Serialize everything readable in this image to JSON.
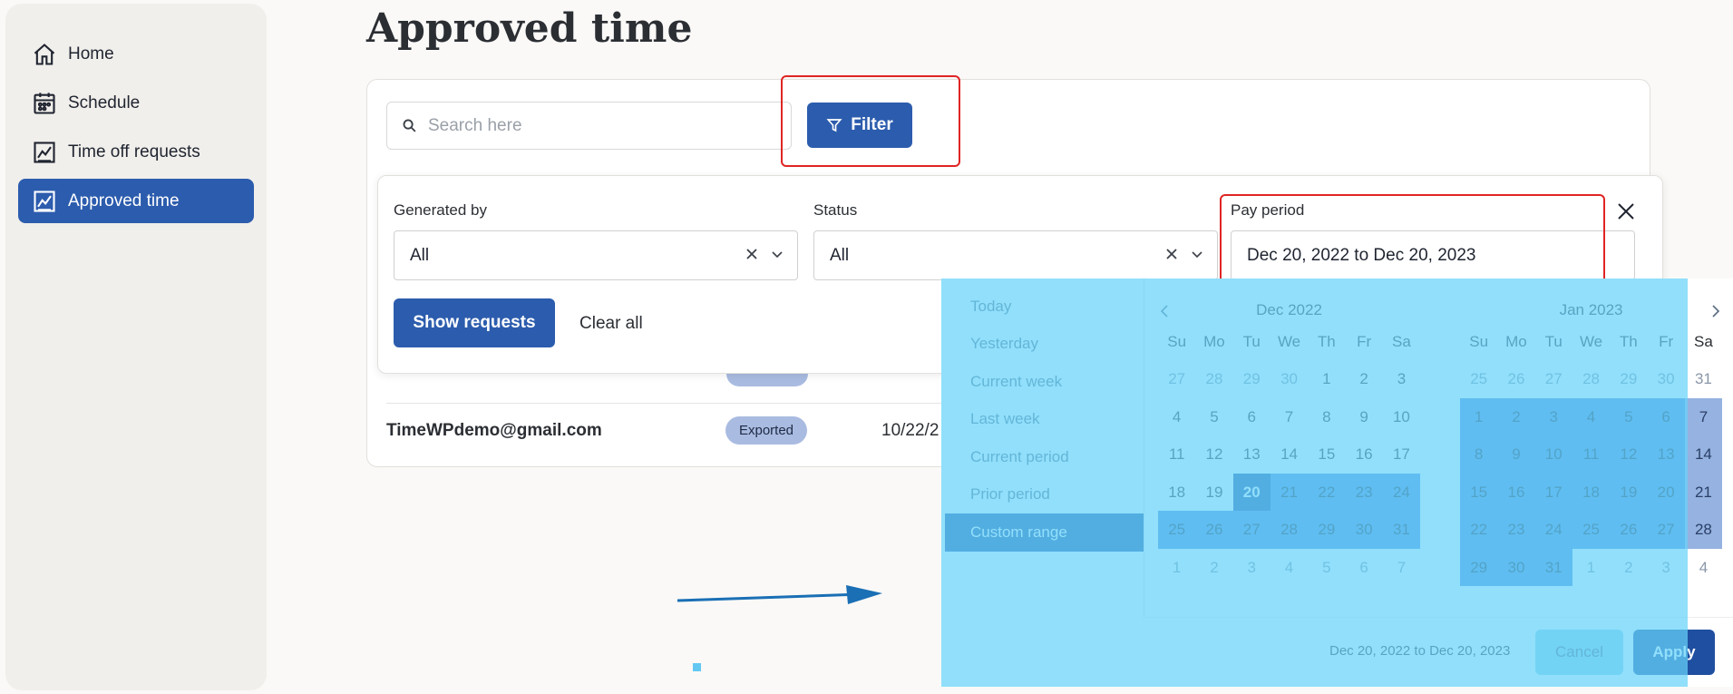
{
  "sidebar": {
    "items": [
      {
        "label": "Home",
        "icon": "home-icon"
      },
      {
        "label": "Schedule",
        "icon": "calendar-icon"
      },
      {
        "label": "Time off requests",
        "icon": "chart-icon"
      },
      {
        "label": "Approved time",
        "icon": "chart-icon",
        "active": true
      }
    ]
  },
  "page": {
    "title": "Approved time"
  },
  "search": {
    "placeholder": "Search here",
    "value": ""
  },
  "toolbar": {
    "filter_label": "Filter"
  },
  "filters": {
    "generated_by": {
      "label": "Generated by",
      "value": "All"
    },
    "status": {
      "label": "Status",
      "value": "All"
    },
    "pay_period": {
      "label": "Pay period",
      "value": "Dec 20, 2022 to Dec 20, 2023"
    },
    "show_label": "Show requests",
    "clear_label": "Clear all"
  },
  "table": {
    "rows": [
      {
        "email": "TimeWPdemo@gmail.com",
        "status": "Exported",
        "date": "10/22/2"
      }
    ]
  },
  "datepicker": {
    "ranges": [
      "Today",
      "Yesterday",
      "Current week",
      "Last week",
      "Current period",
      "Prior period",
      "Custom range"
    ],
    "active_range": "Custom range",
    "weekdays": [
      "Su",
      "Mo",
      "Tu",
      "We",
      "Th",
      "Fr",
      "Sa"
    ],
    "months": [
      {
        "title": "Dec 2022",
        "weeks": [
          [
            {
              "d": "27",
              "s": "off"
            },
            {
              "d": "28",
              "s": "off"
            },
            {
              "d": "29",
              "s": "off"
            },
            {
              "d": "30",
              "s": "off"
            },
            {
              "d": "1"
            },
            {
              "d": "2"
            },
            {
              "d": "3"
            }
          ],
          [
            {
              "d": "4"
            },
            {
              "d": "5"
            },
            {
              "d": "6"
            },
            {
              "d": "7"
            },
            {
              "d": "8"
            },
            {
              "d": "9"
            },
            {
              "d": "10"
            }
          ],
          [
            {
              "d": "11"
            },
            {
              "d": "12"
            },
            {
              "d": "13"
            },
            {
              "d": "14"
            },
            {
              "d": "15"
            },
            {
              "d": "16"
            },
            {
              "d": "17"
            }
          ],
          [
            {
              "d": "18"
            },
            {
              "d": "19"
            },
            {
              "d": "20",
              "s": "start"
            },
            {
              "d": "21",
              "s": "in"
            },
            {
              "d": "22",
              "s": "in"
            },
            {
              "d": "23",
              "s": "in"
            },
            {
              "d": "24",
              "s": "in"
            }
          ],
          [
            {
              "d": "25",
              "s": "in"
            },
            {
              "d": "26",
              "s": "in"
            },
            {
              "d": "27",
              "s": "in"
            },
            {
              "d": "28",
              "s": "in"
            },
            {
              "d": "29",
              "s": "in"
            },
            {
              "d": "30",
              "s": "in"
            },
            {
              "d": "31",
              "s": "in"
            }
          ],
          [
            {
              "d": "1",
              "s": "off"
            },
            {
              "d": "2",
              "s": "off"
            },
            {
              "d": "3",
              "s": "off"
            },
            {
              "d": "4",
              "s": "off"
            },
            {
              "d": "5",
              "s": "off"
            },
            {
              "d": "6",
              "s": "off"
            },
            {
              "d": "7",
              "s": "off"
            }
          ]
        ]
      },
      {
        "title": "Jan 2023",
        "weeks": [
          [
            {
              "d": "25",
              "s": "off"
            },
            {
              "d": "26",
              "s": "off"
            },
            {
              "d": "27",
              "s": "off"
            },
            {
              "d": "28",
              "s": "off"
            },
            {
              "d": "29",
              "s": "off"
            },
            {
              "d": "30",
              "s": "off"
            },
            {
              "d": "31",
              "s": "edge-off"
            }
          ],
          [
            {
              "d": "1",
              "s": "in"
            },
            {
              "d": "2",
              "s": "in"
            },
            {
              "d": "3",
              "s": "in"
            },
            {
              "d": "4",
              "s": "in"
            },
            {
              "d": "5",
              "s": "in"
            },
            {
              "d": "6",
              "s": "in"
            },
            {
              "d": "7",
              "s": "edge"
            }
          ],
          [
            {
              "d": "8",
              "s": "in"
            },
            {
              "d": "9",
              "s": "in"
            },
            {
              "d": "10",
              "s": "in"
            },
            {
              "d": "11",
              "s": "in"
            },
            {
              "d": "12",
              "s": "in"
            },
            {
              "d": "13",
              "s": "in"
            },
            {
              "d": "14",
              "s": "edge"
            }
          ],
          [
            {
              "d": "15",
              "s": "in"
            },
            {
              "d": "16",
              "s": "in"
            },
            {
              "d": "17",
              "s": "in"
            },
            {
              "d": "18",
              "s": "in"
            },
            {
              "d": "19",
              "s": "in"
            },
            {
              "d": "20",
              "s": "in"
            },
            {
              "d": "21",
              "s": "edge"
            }
          ],
          [
            {
              "d": "22",
              "s": "in"
            },
            {
              "d": "23",
              "s": "in"
            },
            {
              "d": "24",
              "s": "in"
            },
            {
              "d": "25",
              "s": "in"
            },
            {
              "d": "26",
              "s": "in"
            },
            {
              "d": "27",
              "s": "in"
            },
            {
              "d": "28",
              "s": "edge"
            }
          ],
          [
            {
              "d": "29",
              "s": "in"
            },
            {
              "d": "30",
              "s": "in"
            },
            {
              "d": "31",
              "s": "in"
            },
            {
              "d": "1",
              "s": "off"
            },
            {
              "d": "2",
              "s": "off"
            },
            {
              "d": "3",
              "s": "off"
            },
            {
              "d": "4",
              "s": "edge-off"
            }
          ]
        ]
      }
    ],
    "range_text": "Dec 20, 2022 to Dec 20, 2023",
    "cancel_label": "Cancel",
    "apply_label": "Apply"
  },
  "colors": {
    "primary": "#2c5cad",
    "highlight": "#66d2fa",
    "annotation_red": "#e02424"
  }
}
